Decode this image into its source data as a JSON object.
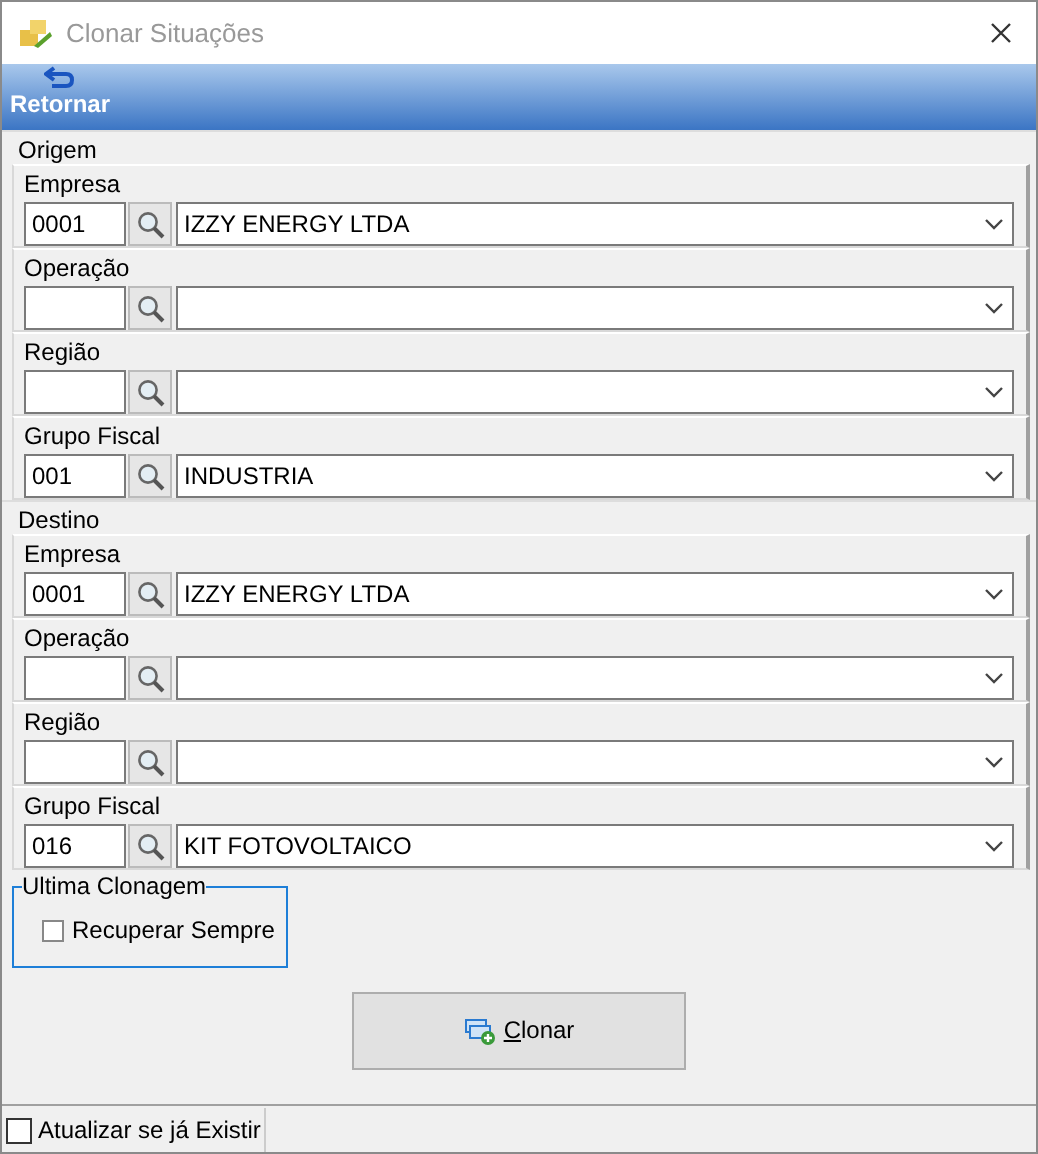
{
  "window": {
    "title": "Clonar Situações"
  },
  "toolbar": {
    "buttons": [
      {
        "label": "Retornar"
      }
    ]
  },
  "sections": [
    {
      "title": "Origem",
      "fields": [
        {
          "label": "Empresa",
          "code": "0001",
          "value": "IZZY ENERGY LTDA"
        },
        {
          "label": "Operação"
        },
        {
          "label": "Região"
        },
        {
          "label": "Grupo Fiscal",
          "code": "001",
          "value": "INDUSTRIA"
        }
      ]
    },
    {
      "title": "Destino",
      "fields": [
        {
          "label": "Empresa",
          "code": "0001",
          "value": "IZZY ENERGY LTDA"
        },
        {
          "label": "Operação"
        },
        {
          "label": "Região"
        },
        {
          "label": "Grupo Fiscal",
          "code": "016",
          "value": "KIT FOTOVOLTAICO"
        }
      ]
    }
  ],
  "last_clone": {
    "title": "Ultima Clonagem",
    "checkbox": {
      "label": "Recuperar Sempre",
      "checked": false
    }
  },
  "clone_button": {
    "label": "Clonar"
  },
  "status_bar": {
    "checkbox": {
      "label": "Atualizar se já Existir",
      "checked": false
    }
  }
}
